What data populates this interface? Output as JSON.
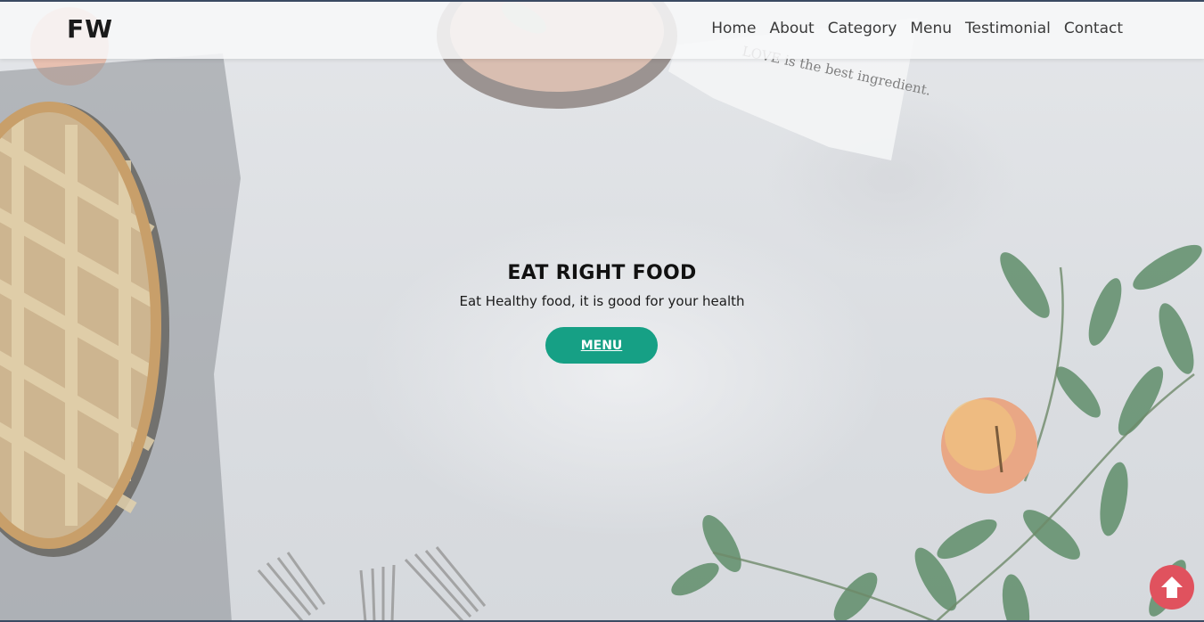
{
  "brand": {
    "logo_text": "FW"
  },
  "nav": {
    "items": [
      {
        "label": "Home"
      },
      {
        "label": "About"
      },
      {
        "label": "Category"
      },
      {
        "label": "Menu"
      },
      {
        "label": "Testimonial"
      },
      {
        "label": "Contact"
      }
    ]
  },
  "hero": {
    "title": "EAT RIGHT FOOD",
    "subtitle": "Eat Healthy food, it is good for your health",
    "button_label": "MENU",
    "napkin_text": "LOVE is the best ingredient."
  },
  "scroll_top": {
    "icon": "arrow-up-icon"
  },
  "colors": {
    "accent": "#16a085",
    "scroll_top_bg": "#e0525e",
    "text_dark": "#111111",
    "nav_text": "#3a3a3a"
  }
}
